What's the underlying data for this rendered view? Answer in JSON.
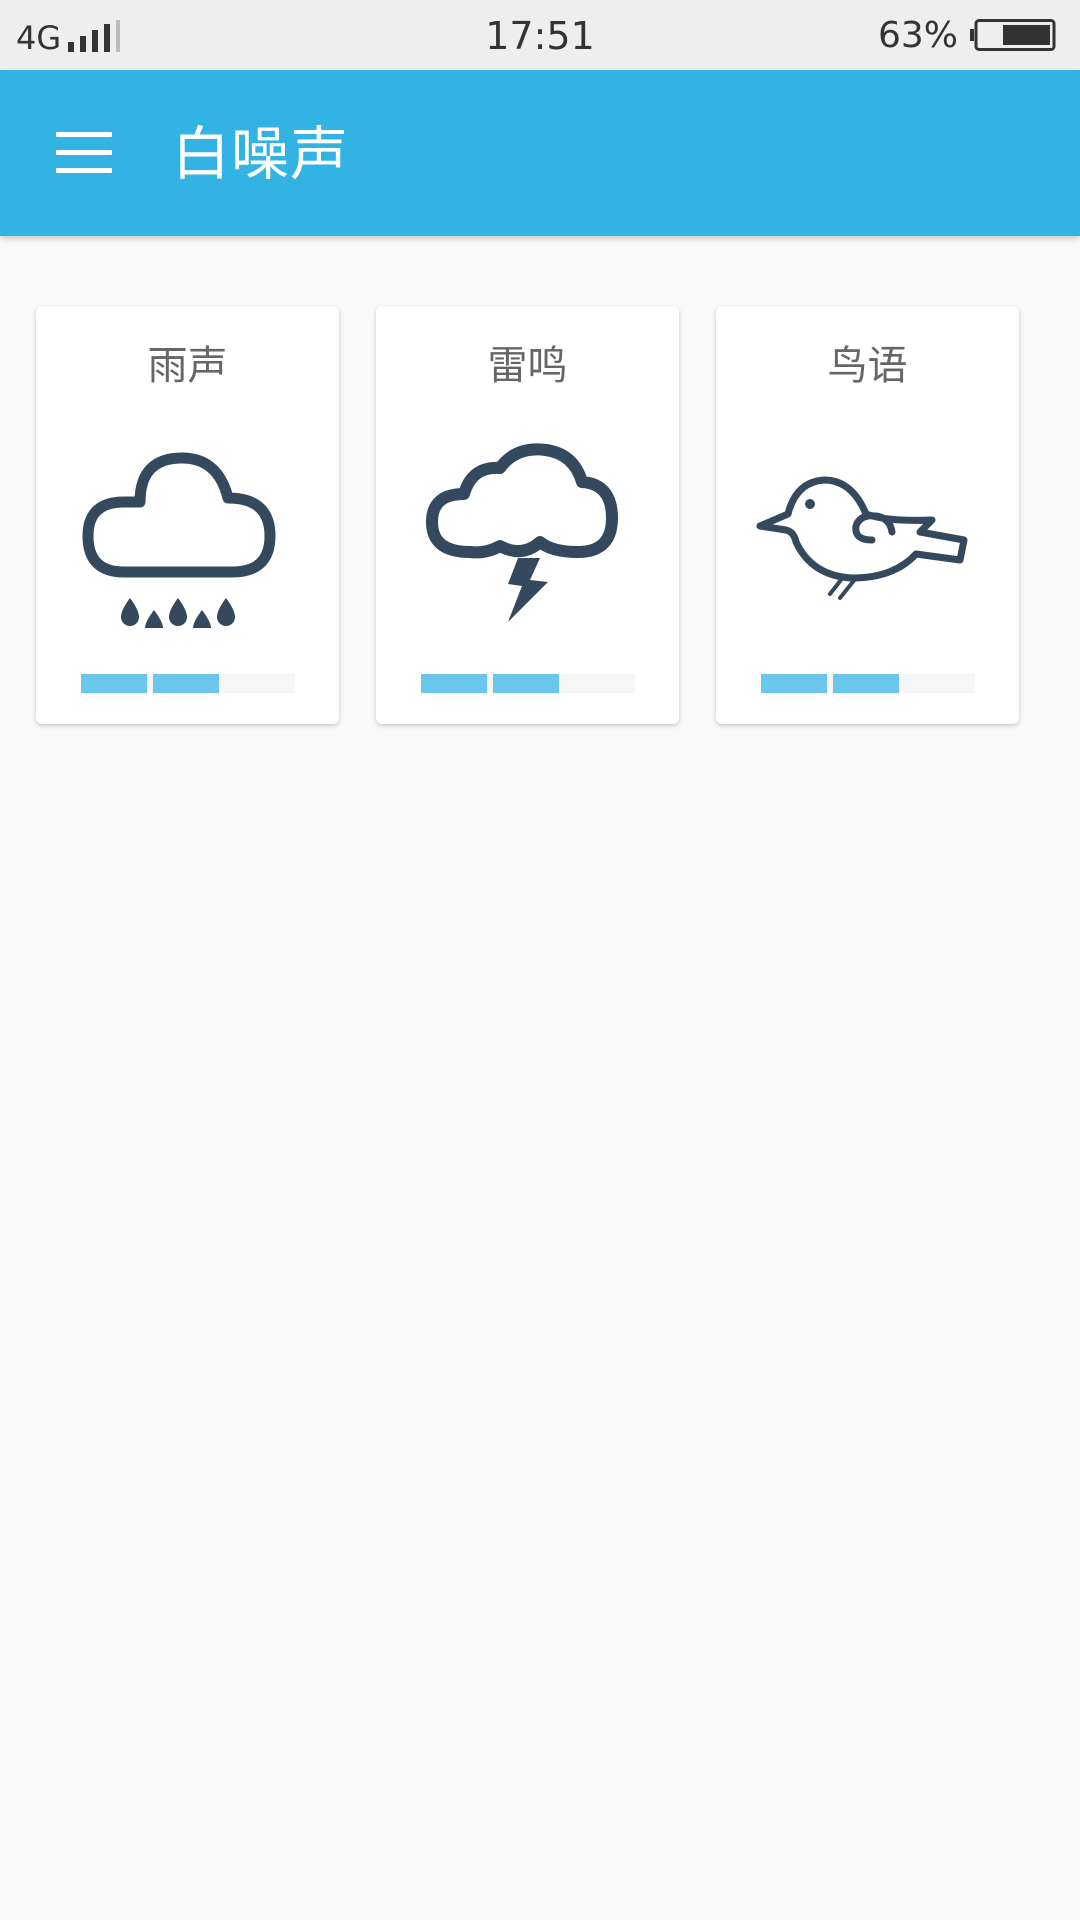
{
  "status_bar": {
    "network": "4G",
    "time": "17:51",
    "battery_percent": "63%",
    "battery_level": 0.63
  },
  "app_bar": {
    "title": "白噪声",
    "menu_icon": "hamburger-menu-icon",
    "background_color": "#33b3e4"
  },
  "sounds": [
    {
      "label": "雨声",
      "icon": "rain-cloud-icon",
      "volume_level": 0.67
    },
    {
      "label": "雷鸣",
      "icon": "thunder-cloud-icon",
      "volume_level": 0.67
    },
    {
      "label": "鸟语",
      "icon": "bird-icon",
      "volume_level": 0.67
    }
  ],
  "colors": {
    "accent": "#6bc6ee",
    "icon": "#34495e"
  }
}
